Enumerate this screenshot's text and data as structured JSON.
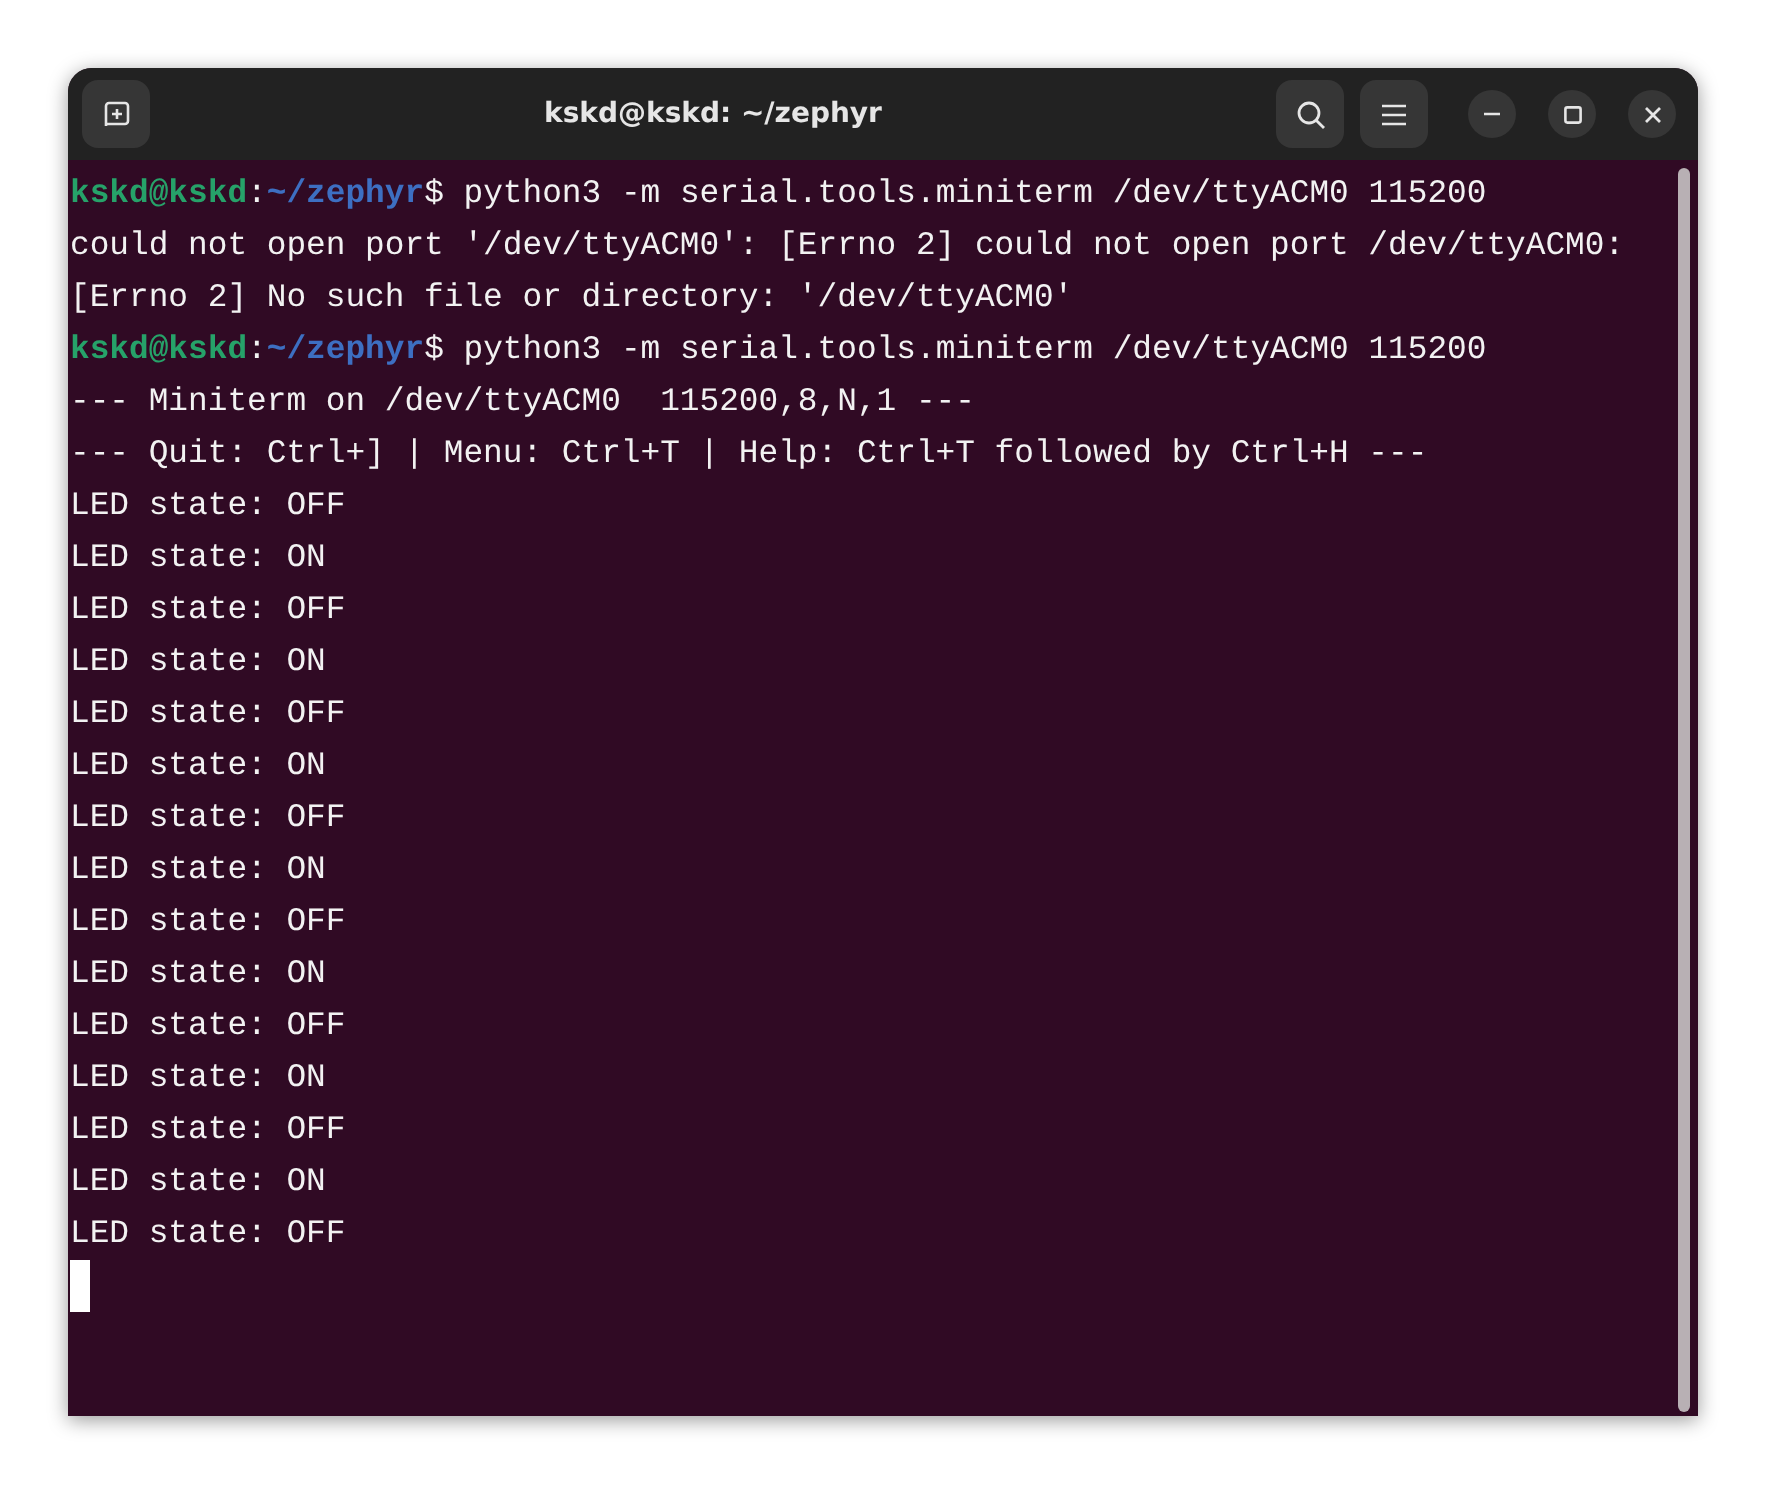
{
  "window": {
    "title": "kskd@kskd: ~/zephyr"
  },
  "lines": [
    {
      "kind": "prompt",
      "user": "kskd@kskd",
      "separator": ":",
      "path": "~/zephyr",
      "command": "$ python3 -m serial.tools.miniterm /dev/ttyACM0 115200"
    },
    {
      "kind": "output",
      "text": "could not open port '/dev/ttyACM0': [Errno 2] could not open port /dev/ttyACM0: [Errno 2] No such file or directory: '/dev/ttyACM0'"
    },
    {
      "kind": "prompt",
      "user": "kskd@kskd",
      "separator": ":",
      "path": "~/zephyr",
      "command": "$ python3 -m serial.tools.miniterm /dev/ttyACM0 115200"
    },
    {
      "kind": "output",
      "text": "--- Miniterm on /dev/ttyACM0  115200,8,N,1 ---"
    },
    {
      "kind": "output",
      "text": "--- Quit: Ctrl+] | Menu: Ctrl+T | Help: Ctrl+T followed by Ctrl+H ---"
    },
    {
      "kind": "output",
      "text": "LED state: OFF"
    },
    {
      "kind": "output",
      "text": "LED state: ON"
    },
    {
      "kind": "output",
      "text": "LED state: OFF"
    },
    {
      "kind": "output",
      "text": "LED state: ON"
    },
    {
      "kind": "output",
      "text": "LED state: OFF"
    },
    {
      "kind": "output",
      "text": "LED state: ON"
    },
    {
      "kind": "output",
      "text": "LED state: OFF"
    },
    {
      "kind": "output",
      "text": "LED state: ON"
    },
    {
      "kind": "output",
      "text": "LED state: OFF"
    },
    {
      "kind": "output",
      "text": "LED state: ON"
    },
    {
      "kind": "output",
      "text": "LED state: OFF"
    },
    {
      "kind": "output",
      "text": "LED state: ON"
    },
    {
      "kind": "output",
      "text": "LED state: OFF"
    },
    {
      "kind": "output",
      "text": "LED state: ON"
    },
    {
      "kind": "output",
      "text": "LED state: OFF"
    },
    {
      "kind": "cursor"
    }
  ]
}
